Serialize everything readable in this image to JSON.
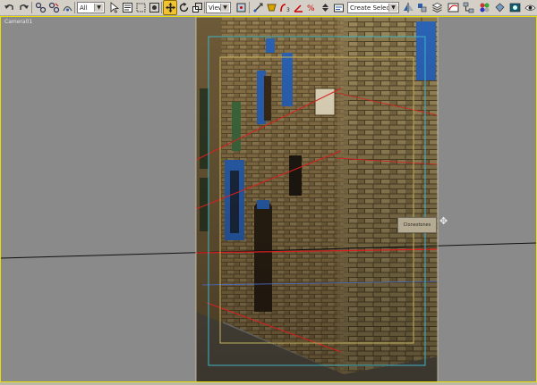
{
  "toolbar": {
    "selection_filter": "All",
    "reference_coord": "View",
    "named_selection_placeholder": "Create Selection Set",
    "active_tool": "select-and-move"
  },
  "viewport": {
    "label": "Camera01",
    "tooltip_text": "Clonestones"
  },
  "colors": {
    "active_viewport_border": "#e8e000",
    "viewport_background": "#8a8a8a",
    "active_tool_highlight": "#f1c232",
    "horizon_line": "#000000",
    "perspective_lines": "#d81f1f",
    "safe_frame_outer": "#3fb3c6",
    "safe_frame_inner": "#c8b35a"
  }
}
